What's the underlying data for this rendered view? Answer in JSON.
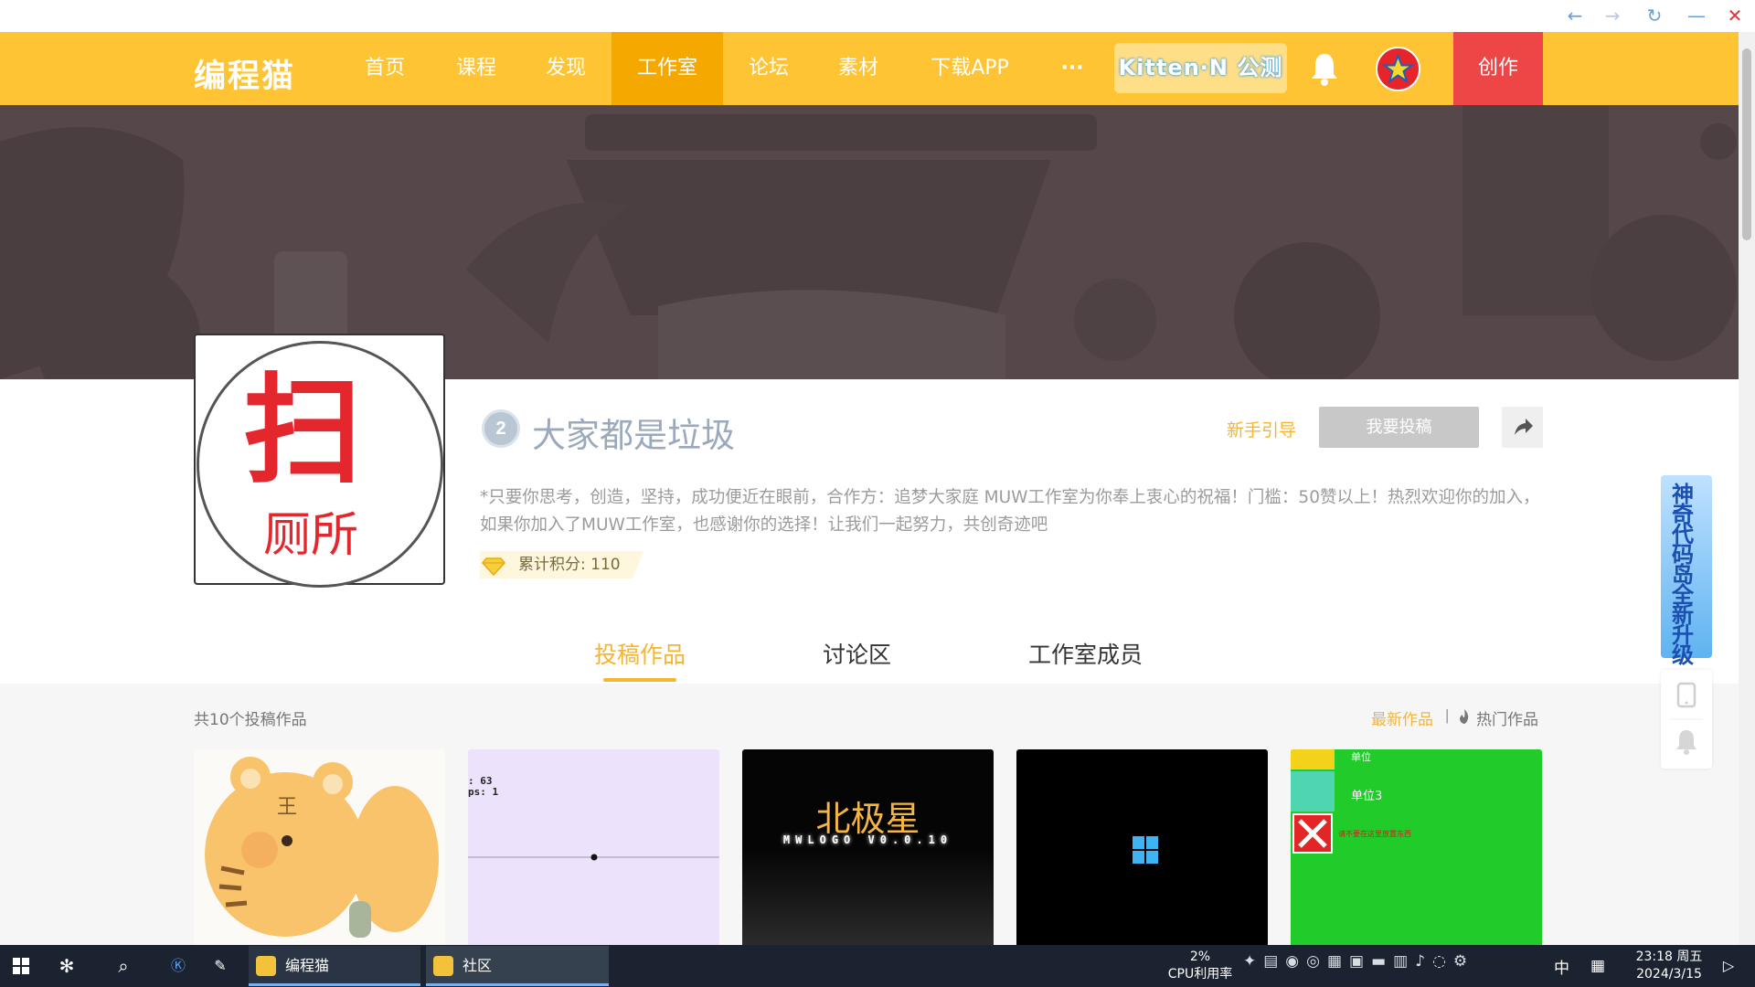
{
  "browser": {
    "back_icon": "arrow-left-icon",
    "forward_icon": "arrow-right-icon",
    "reload_icon": "reload-icon",
    "minimize_icon": "minimize-icon",
    "close_icon": "close-icon"
  },
  "nav": {
    "logo": "编程猫",
    "items": [
      {
        "label": "首页"
      },
      {
        "label": "课程"
      },
      {
        "label": "发现"
      },
      {
        "label": "工作室",
        "active": true
      },
      {
        "label": "论坛"
      },
      {
        "label": "素材"
      },
      {
        "label": "下载APP"
      },
      {
        "label": "···"
      }
    ],
    "kitten_badge": "Kitten·N 公测",
    "create_label": "创作",
    "colors": {
      "bar": "#fec433",
      "active": "#f5a900",
      "create": "#ee4547"
    }
  },
  "avatar": {
    "big_char": "扫",
    "small_text": "厕所"
  },
  "studio": {
    "level": "2",
    "name": "大家都是垃圾",
    "guide_label": "新手引导",
    "submit_label": "我要投稿",
    "description": "*只要你思考，创造，坚持，成功便近在眼前，合作方：追梦大家庭 MUW工作室为你奉上衷心的祝福！门槛：50赞以上！热烈欢迎你的加入，如果你加入了MUW工作室，也感谢你的选择！让我们一起努力，共创奇迹吧",
    "points_label": "累计积分: 110"
  },
  "tabs": [
    {
      "label": "投稿作品",
      "active": true
    },
    {
      "label": "讨论区"
    },
    {
      "label": "工作室成员"
    }
  ],
  "works": {
    "count_label": "共10个投稿作品",
    "sort_newest": "最新作品",
    "sort_separator": "|",
    "sort_hot": "热门作品",
    "cards": [
      {
        "thumb": "tiger-cartoon"
      },
      {
        "thumb": "purple-scene",
        "line1": ": 63",
        "line2": "ps:  1"
      },
      {
        "thumb": "title-screen",
        "title": "北极星",
        "subtitle": "MWLOGO  V0.0.10"
      },
      {
        "thumb": "windows-logo"
      },
      {
        "thumb": "green-panel",
        "text1": "单位",
        "text2": "单位3",
        "text3": "请不要在这里放置东西"
      }
    ]
  },
  "side": {
    "promo_text": "神奇代码岛全新升级"
  },
  "taskbar": {
    "apps": [
      {
        "label": "编程猫"
      },
      {
        "label": "社区"
      }
    ],
    "cpu_percent": "2%",
    "cpu_label": "CPU利用率",
    "ime": "中",
    "time": "23:18 周五",
    "date": "2024/3/15"
  }
}
